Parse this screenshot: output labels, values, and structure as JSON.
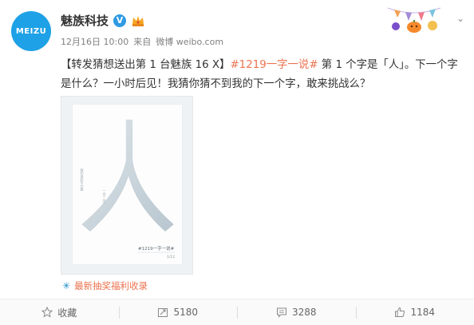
{
  "author": {
    "avatar_text": "MEIZU",
    "name": "魅族科技",
    "verified_mark": "V"
  },
  "meta": {
    "time": "12月16日 10:00",
    "source_prefix": "来自",
    "source": "微博 weibo.com"
  },
  "post": {
    "text_before": "【转发猜想送出第 1 台魅族 16 X】",
    "topic": "#1219一字一说#",
    "text_after": " 第 1 个字是「人」。下一个字是什么？一小时后见！我猜你猜不到我的下一个字，敢来挑战么？"
  },
  "poster": {
    "character": "人",
    "side_text_1": "我们说好不分散",
    "side_text_2": "一念一念一",
    "caption": "#1219一字一说#",
    "page": "1/12"
  },
  "lottery": {
    "label": "最新抽奖福利收录",
    "icon": "lottery-icon"
  },
  "footer": {
    "favorite_label": "收藏",
    "repost_count": "5180",
    "comment_count": "3288",
    "like_count": "1184"
  },
  "colors": {
    "accent": "#eb7350",
    "brand": "#1ea1e6",
    "link": "#1e8ec6"
  }
}
